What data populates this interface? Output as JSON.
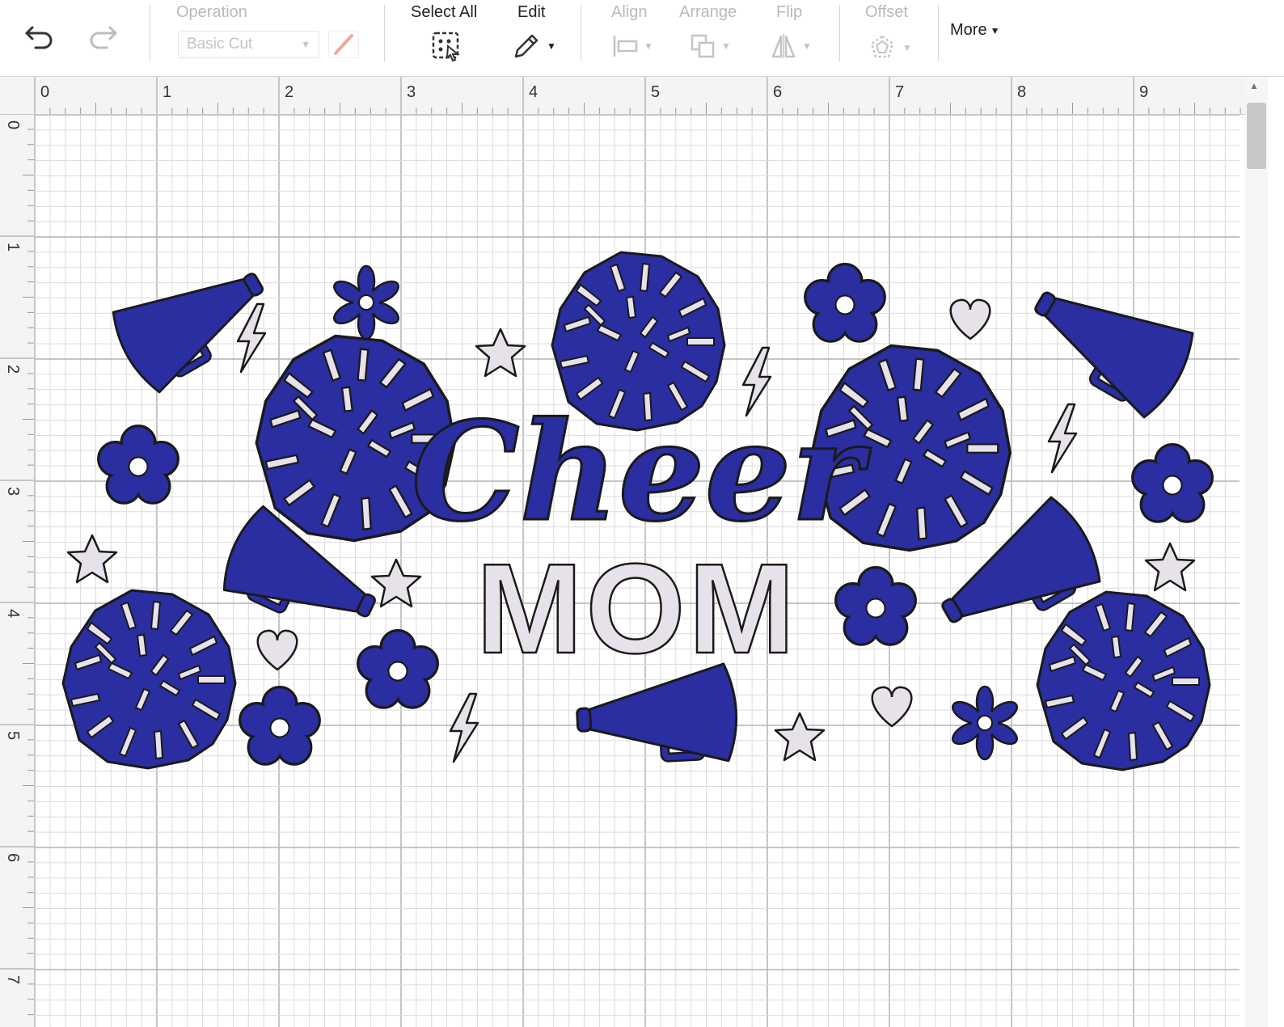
{
  "toolbar": {
    "undo_icon": "undo-icon",
    "redo_icon": "redo-icon",
    "operation": {
      "label": "Operation",
      "value": "Basic Cut",
      "pen_icon": "pen-color-icon"
    },
    "select_all": {
      "label": "Select All",
      "icon": "select-all-icon"
    },
    "edit": {
      "label": "Edit",
      "icon": "pencil-icon"
    },
    "align": {
      "label": "Align",
      "icon": "align-icon"
    },
    "arrange": {
      "label": "Arrange",
      "icon": "arrange-icon"
    },
    "flip": {
      "label": "Flip",
      "icon": "flip-icon"
    },
    "offset": {
      "label": "Offset",
      "icon": "offset-icon"
    },
    "more": {
      "label": "More"
    }
  },
  "ruler": {
    "horizontal": [
      "0",
      "1",
      "2",
      "3",
      "4",
      "5",
      "6",
      "7",
      "8",
      "9"
    ],
    "vertical": [
      "0",
      "1",
      "2",
      "3",
      "4",
      "5",
      "6",
      "7"
    ]
  },
  "design": {
    "title_script": "Cheer",
    "title_block": "MOM",
    "primary_color": "#2a2ea0",
    "secondary_color": "#e7e2ea",
    "outline_color": "#1a1a1a",
    "elements": [
      "megaphone",
      "megaphone",
      "megaphone",
      "megaphone",
      "megaphone",
      "pom-pom",
      "pom-pom",
      "pom-pom",
      "pom-pom",
      "pom-pom",
      "flower",
      "flower",
      "flower",
      "flower",
      "flower",
      "flower",
      "flower",
      "star",
      "star",
      "star",
      "star",
      "star",
      "heart",
      "heart",
      "heart",
      "lightning",
      "lightning",
      "lightning",
      "lightning"
    ]
  },
  "colors": {
    "grid_minor": "#dcdcdc",
    "grid_major": "#b3b3b3",
    "ruler_bg": "#f4f4f4"
  }
}
